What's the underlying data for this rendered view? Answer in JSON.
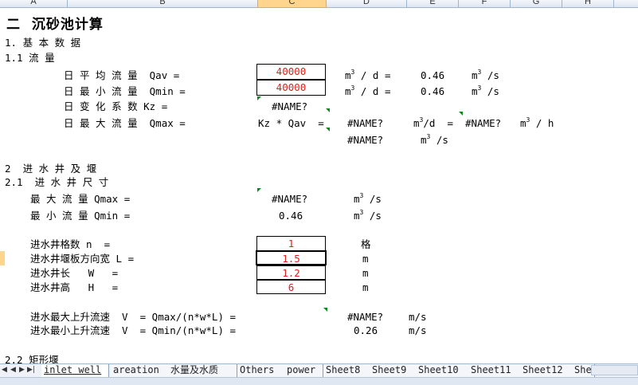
{
  "columns": [
    "A",
    "B",
    "C",
    "D",
    "E",
    "F",
    "G",
    "H"
  ],
  "title": "二  沉砂池计算",
  "s1": "1. 基 本 数 据",
  "s11": "1.1 流 量",
  "r_qav_label": "日 平 均 流 量  Qav =",
  "r_qav_val": "40000",
  "r_qmin_label": "日 最 小 流 量  Qmin =",
  "r_qmin_val": "40000",
  "unit_m3d": "m",
  "unit_m3d_sup": "3",
  "unit_m3d_tail": " / d =",
  "qav_ms": "0.46",
  "qmin_ms": "0.46",
  "unit_m3s": "m",
  "unit_m3s_sup": "3",
  "unit_m3s_tail": " /s",
  "kz_label": "日 变 化 系 数 Kz =",
  "name_err": "#NAME?",
  "qmax_label": "日 最 大 流 量  Qmax =",
  "qmax_formula": "Kz * Qav  =",
  "unit_m3d2": "m",
  "unit_m3d2_tail": "/d  =",
  "unit_m3h": "m",
  "unit_m3h_tail": " / h",
  "s2": "2  进 水 井 及 堰",
  "s21": "2.1  进 水 井 尺 寸",
  "w_qmax_label": "最 大 流 量 Qmax =",
  "w_qmin_label": "最 小 流 量 Qmin =",
  "w_qmin_val": "0.46",
  "n_label": "进水井格数 n  =",
  "n_val": "1",
  "n_unit": "格",
  "L_label": "进水井堰板方向宽 L =",
  "L_val": "1.5",
  "W_label": "进水井长   W   =",
  "W_val": "1.2",
  "H_label": "进水井高   H   =",
  "H_val": "6",
  "m_unit": "m",
  "vmax_label": "进水最大上升流速  V  = Qmax/(n*w*L) =",
  "vmin_label": "进水最小上升流速  V  = Qmin/(n*w*L) =",
  "vmin_val": "0.26",
  "ms_unit": "m/s",
  "s22": "2.2 矩形堰",
  "tabs": [
    "inlet well",
    "areation",
    "水量及水质",
    "Others",
    "power",
    "Sheet8",
    "Sheet9",
    "Sheet10",
    "Sheet11",
    "Sheet12",
    "She"
  ],
  "nav_icons": [
    "first-sheet-icon",
    "prev-sheet-icon",
    "next-sheet-icon",
    "last-sheet-icon"
  ]
}
